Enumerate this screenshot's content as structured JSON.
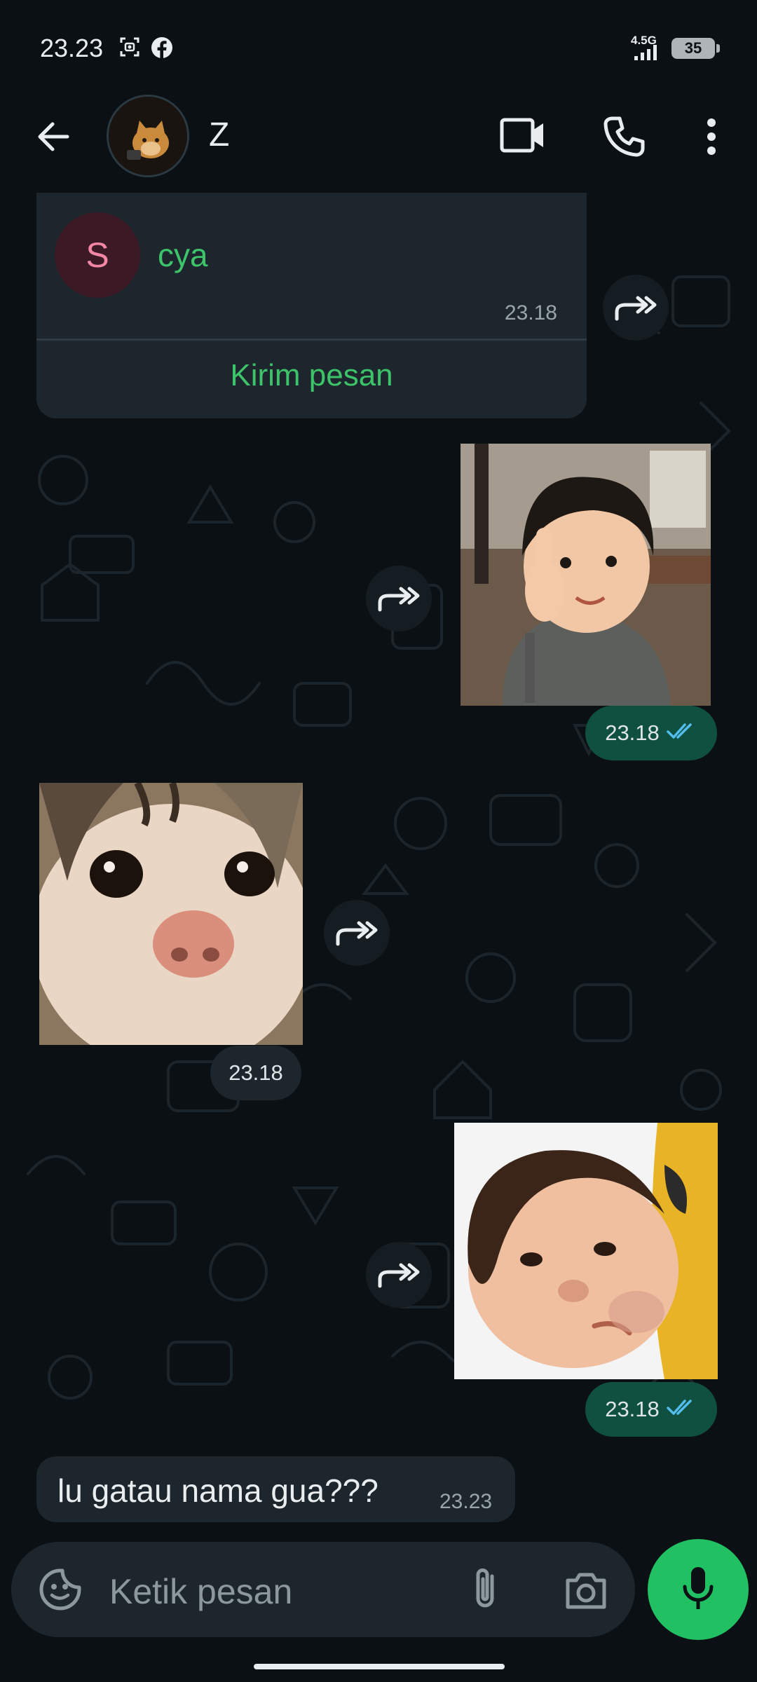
{
  "status_bar": {
    "time": "23.23",
    "network": "4.5G",
    "battery": "35",
    "icons": [
      "screenshot-icon",
      "facebook-icon",
      "signal-icon",
      "battery-icon"
    ]
  },
  "header": {
    "contact_name": "Z",
    "icons": [
      "back-arrow-icon",
      "video-call-icon",
      "voice-call-icon",
      "more-options-icon"
    ]
  },
  "messages": {
    "contact_card": {
      "initial": "S",
      "name": "cya",
      "time": "23.18",
      "action": "Kirim pesan"
    },
    "sticker_1": {
      "description_icon": "child-thumbs-up-sticker",
      "time": "23.18",
      "status": "read"
    },
    "sticker_2": {
      "description_icon": "cat-closeup-sticker",
      "time": "23.18"
    },
    "sticker_3": {
      "description_icon": "child-pout-sticker",
      "time": "23.18",
      "status": "read"
    },
    "text_1": {
      "text": "lu gatau nama gua???",
      "time": "23.23"
    }
  },
  "composer": {
    "placeholder": "Ketik pesan",
    "icons": [
      "sticker-icon",
      "attach-icon",
      "camera-icon",
      "mic-icon"
    ]
  },
  "colors": {
    "background": "#0b1014",
    "incoming_bubble": "#1d262c",
    "outgoing_bubble": "#0f5041",
    "accent_green": "#21c063",
    "read_ticks": "#53bdeb"
  }
}
